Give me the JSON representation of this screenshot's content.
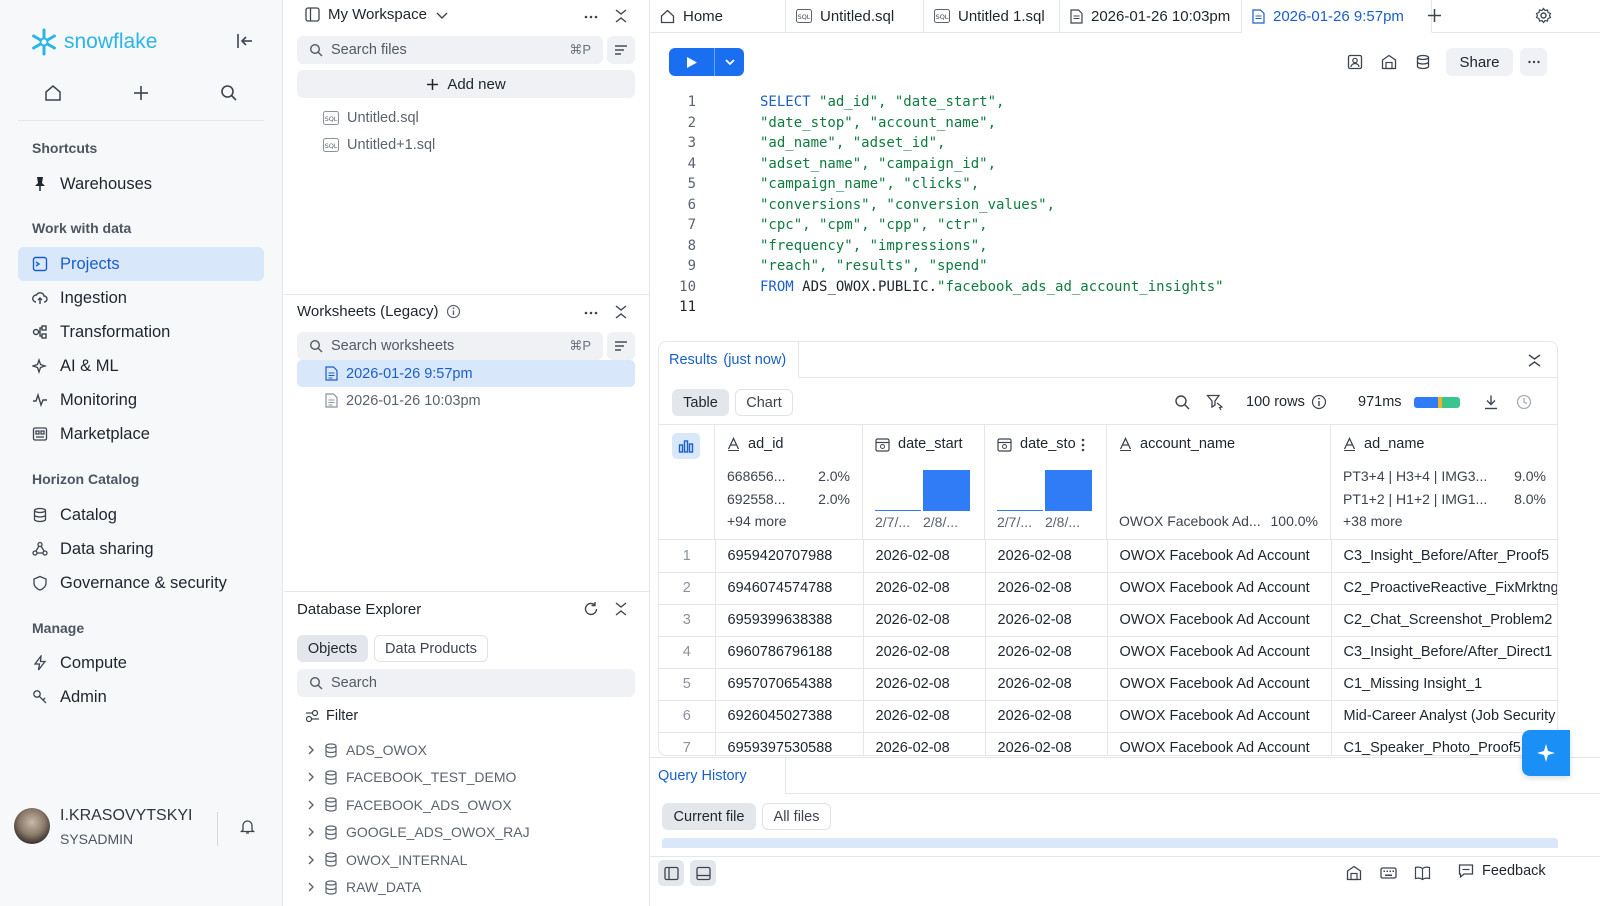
{
  "sidebar": {
    "logo_text": "snowflake",
    "shortcuts_heading": "Shortcuts",
    "shortcuts": [
      {
        "label": "Warehouses"
      }
    ],
    "work_heading": "Work with data",
    "work_items": [
      {
        "label": "Projects",
        "active": true
      },
      {
        "label": "Ingestion"
      },
      {
        "label": "Transformation"
      },
      {
        "label": "AI & ML"
      },
      {
        "label": "Monitoring"
      },
      {
        "label": "Marketplace"
      }
    ],
    "horizon_heading": "Horizon Catalog",
    "horizon_items": [
      {
        "label": "Catalog"
      },
      {
        "label": "Data sharing"
      },
      {
        "label": "Governance & security"
      }
    ],
    "manage_heading": "Manage",
    "manage_items": [
      {
        "label": "Compute"
      },
      {
        "label": "Admin"
      }
    ],
    "user": {
      "name": "I.KRASOVYTSKYI",
      "role": "SYSADMIN"
    }
  },
  "workspace": {
    "title": "My Workspace",
    "search_placeholder": "Search files",
    "search_shortcut": "⌘P",
    "add_new_label": "Add new",
    "files": [
      {
        "name": "Untitled.sql"
      },
      {
        "name": "Untitled+1.sql"
      }
    ]
  },
  "worksheets": {
    "title": "Worksheets (Legacy)",
    "search_placeholder": "Search worksheets",
    "search_shortcut": "⌘P",
    "items": [
      {
        "name": "2026-01-26 9:57pm",
        "selected": true
      },
      {
        "name": "2026-01-26 10:03pm"
      }
    ]
  },
  "db_explorer": {
    "title": "Database Explorer",
    "tabs": [
      "Objects",
      "Data Products"
    ],
    "search_placeholder": "Search",
    "filter_label": "Filter",
    "databases": [
      "ADS_OWOX",
      "FACEBOOK_TEST_DEMO",
      "FACEBOOK_ADS_OWOX",
      "GOOGLE_ADS_OWOX_RAJ",
      "OWOX_INTERNAL",
      "RAW_DATA"
    ]
  },
  "tabs": [
    {
      "label": "Home",
      "icon": "home-icon"
    },
    {
      "label": "Untitled.sql",
      "icon": "sql-icon"
    },
    {
      "label": "Untitled 1.sql",
      "icon": "sql-icon"
    },
    {
      "label": "2026-01-26 10:03pm",
      "icon": "doc-icon"
    },
    {
      "label": "2026-01-26 9:57pm",
      "icon": "doc-icon",
      "active": true
    }
  ],
  "toolbar": {
    "share_label": "Share"
  },
  "editor": {
    "lines": [
      {
        "n": "1",
        "a": "SELECT ",
        "b": "\"ad_id\", \"date_start\","
      },
      {
        "n": "2",
        "a": "",
        "b": "\"date_stop\", \"account_name\","
      },
      {
        "n": "3",
        "a": "",
        "b": "\"ad_name\", \"adset_id\","
      },
      {
        "n": "4",
        "a": "",
        "b": "\"adset_name\", \"campaign_id\","
      },
      {
        "n": "5",
        "a": "",
        "b": "\"campaign_name\", \"clicks\","
      },
      {
        "n": "6",
        "a": "",
        "b": "\"conversions\", \"conversion_values\","
      },
      {
        "n": "7",
        "a": "",
        "b": "\"cpc\", \"cpm\", \"cpp\", \"ctr\","
      },
      {
        "n": "8",
        "a": "",
        "b": "\"frequency\", \"impressions\","
      },
      {
        "n": "9",
        "a": "",
        "b": "\"reach\", \"results\", \"spend\""
      },
      {
        "n": "10",
        "a": "FROM ",
        "b": "ADS_OWOX.PUBLIC.",
        "c": "\"facebook_ads_ad_account_insights\""
      },
      {
        "n": "11",
        "a": "",
        "b": ""
      }
    ]
  },
  "results": {
    "tab_label": "Results",
    "tab_time": "(just now)",
    "view_tabs": [
      "Table",
      "Chart"
    ],
    "rows_count": "100 rows",
    "duration": "971ms",
    "columns": [
      {
        "name": "ad_id",
        "stats": [
          {
            "v": "668656...",
            "p": "2.0%"
          },
          {
            "v": "692558...",
            "p": "2.0%"
          }
        ],
        "more": "+94 more"
      },
      {
        "name": "date_start",
        "hist_labels": [
          "2/7/...",
          "2/8/..."
        ]
      },
      {
        "name": "date_sto",
        "hist_labels": [
          "2/7/...",
          "2/8/..."
        ]
      },
      {
        "name": "account_name",
        "stats": [
          {
            "v": "OWOX Facebook Ad...",
            "p": "100.0%"
          }
        ]
      },
      {
        "name": "ad_name",
        "stats": [
          {
            "v": "PT3+4 | H3+4 | IMG3...",
            "p": "9.0%"
          },
          {
            "v": "PT1+2 | H1+2 | IMG1...",
            "p": "8.0%"
          }
        ],
        "more": "+38 more"
      }
    ],
    "rows": [
      [
        "1",
        "6959420707988",
        "2026-02-08",
        "2026-02-08",
        "OWOX Facebook Ad Account",
        "C3_Insight_Before/After_Proof5"
      ],
      [
        "2",
        "6946074574788",
        "2026-02-08",
        "2026-02-08",
        "OWOX Facebook Ad Account",
        "C2_ProactiveReactive_FixMrktng"
      ],
      [
        "3",
        "6959399638388",
        "2026-02-08",
        "2026-02-08",
        "OWOX Facebook Ad Account",
        "C2_Chat_Screenshot_Problem2"
      ],
      [
        "4",
        "6960786796188",
        "2026-02-08",
        "2026-02-08",
        "OWOX Facebook Ad Account",
        "C3_Insight_Before/After_Direct1"
      ],
      [
        "5",
        "6957070654388",
        "2026-02-08",
        "2026-02-08",
        "OWOX Facebook Ad Account",
        "C1_Missing Insight_1"
      ],
      [
        "6",
        "6926045027388",
        "2026-02-08",
        "2026-02-08",
        "OWOX Facebook Ad Account",
        "Mid-Career Analyst (Job Security"
      ],
      [
        "7",
        "6959397530588",
        "2026-02-08",
        "2026-02-08",
        "OWOX Facebook Ad Account",
        "C1_Speaker_Photo_Proof5"
      ]
    ]
  },
  "query_history": {
    "title": "Query History",
    "filters": [
      "Current file",
      "All files"
    ]
  },
  "footer": {
    "feedback_label": "Feedback"
  },
  "colors": {
    "accent": "#1a5fc9",
    "run_button": "#1a6ff0",
    "selected_bg": "#d9e7fb",
    "hist_bar": "#2f7cf6"
  }
}
